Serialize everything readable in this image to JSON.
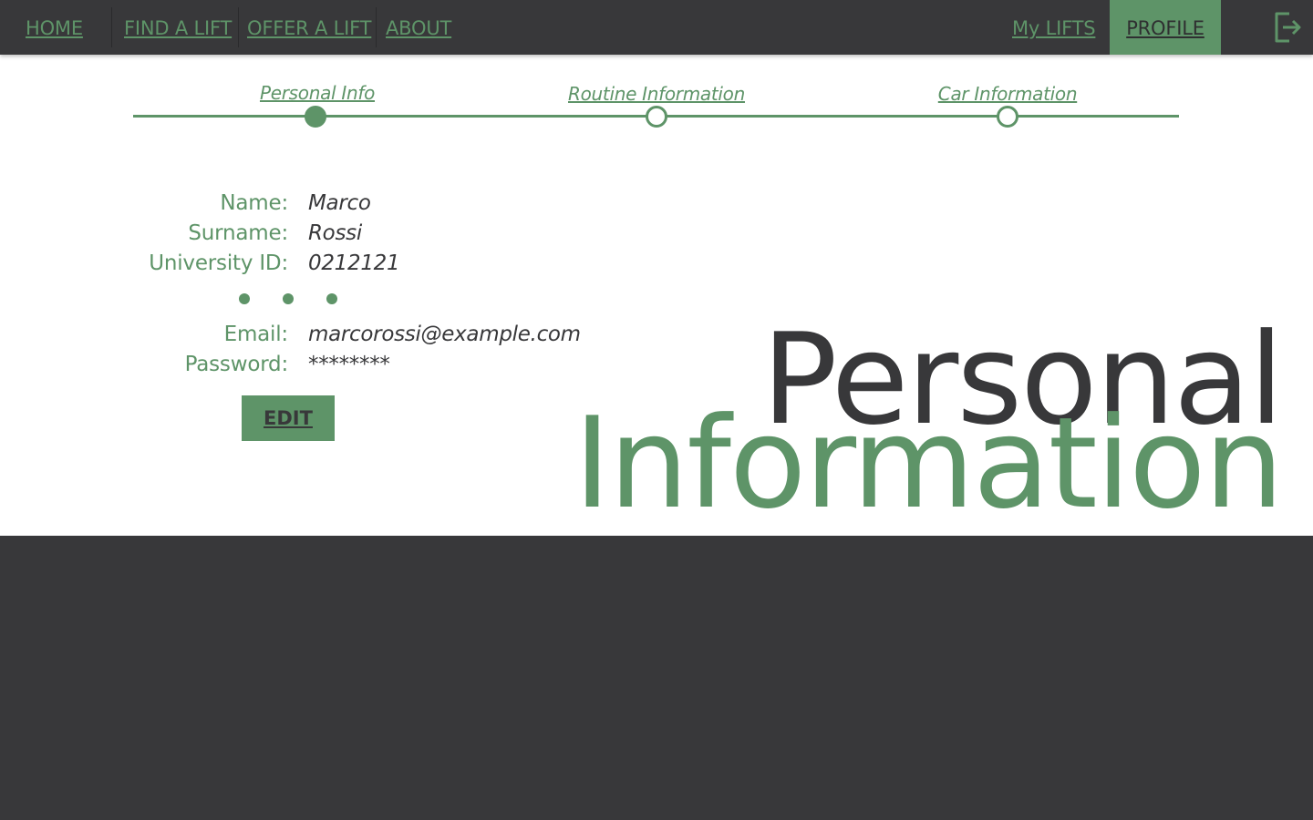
{
  "nav": {
    "home": "HOME",
    "find_lift": "FIND A LIFT",
    "offer_lift": "OFFER A LIFT",
    "about": "ABOUT",
    "my_lifts": "My LIFTS",
    "profile": "PROFILE",
    "active": "PROFILE",
    "logout_icon": "logout-icon"
  },
  "stepper": {
    "steps": [
      {
        "label": "Personal Info",
        "state": "active"
      },
      {
        "label": "Routine Information",
        "state": "inactive"
      },
      {
        "label": "Car Information",
        "state": "inactive"
      }
    ]
  },
  "personal": {
    "name_label": "Name:",
    "name_value": "Marco",
    "surname_label": "Surname:",
    "surname_value": "Rossi",
    "university_id_label": "University ID:",
    "university_id_value": "0212121",
    "email_label": "Email:",
    "email_value": "marcorossi@example.com",
    "password_label": "Password:",
    "password_value": "********",
    "edit_label": "EDIT"
  },
  "heading": {
    "line1": "Personal",
    "line2": "Information"
  },
  "colors": {
    "accent": "#5e9468",
    "dark": "#38383a",
    "background": "#ffffff"
  }
}
